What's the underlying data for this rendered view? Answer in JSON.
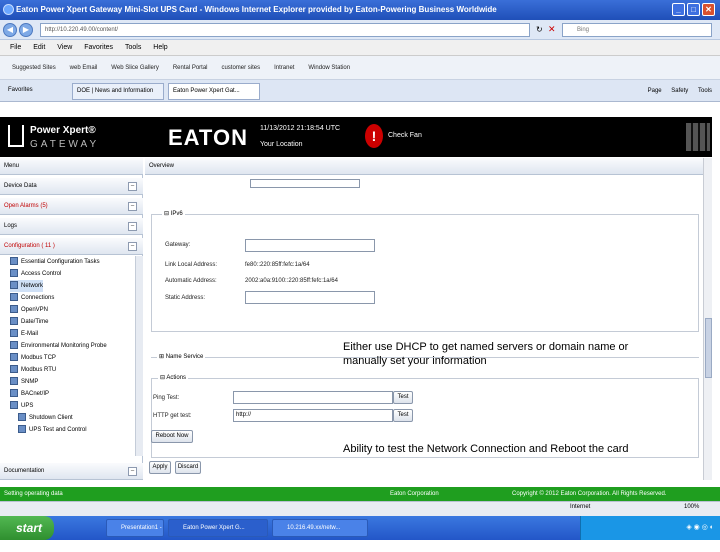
{
  "window": {
    "title": "Eaton Power Xpert Gateway Mini-Slot UPS Card - Windows Internet Explorer provided by Eaton-Powering Business Worldwide"
  },
  "browser": {
    "address": "http://10.220.49.00/content/",
    "search_placeholder": "Bing",
    "menu": [
      "File",
      "Edit",
      "View",
      "Favorites",
      "Tools",
      "Help"
    ],
    "favorites": [
      "Suggested Sites",
      "web Email",
      "Web Slice Gallery",
      "Rental Portal",
      "customer sites",
      "Intranet",
      "Window Station"
    ],
    "tabs": [
      {
        "label": "Favorites"
      },
      {
        "label": "DOE | News and Information"
      },
      {
        "label": "Eaton Power Xpert Gat..."
      }
    ],
    "commands": [
      "Page",
      "Safety",
      "Tools"
    ]
  },
  "header": {
    "brand": "Power Xpert®",
    "subbrand": "GATEWAY",
    "company": "EATON",
    "datetime": "11/13/2012 21:18:54 UTC",
    "location": "Your Location",
    "alert_text": "Check Fan"
  },
  "sidebar": {
    "menu_label": "Menu",
    "device_data": "Device Data",
    "open_alarms": "Open Alarms (5)",
    "logs": "Logs",
    "configuration": "Configuration ( 11 )",
    "tree": [
      "Essential Configuration Tasks",
      "Access Control",
      "Network",
      "Connections",
      "OpenVPN",
      "Date/Time",
      "E-Mail",
      "Environmental Monitoring Probe",
      "Modbus TCP",
      "Modbus RTU",
      "SNMP",
      "BACnet/IP",
      "UPS",
      "Shutdown Client",
      "UPS Test and Control"
    ],
    "documentation": "Documentation"
  },
  "content": {
    "header": "Overview",
    "ipv6": {
      "legend": "IPv6",
      "gateway_label": "Gateway:",
      "gateway_value": "",
      "link_local_label": "Link Local Address:",
      "link_local_value": "fe80::220:85ff:fefc:1a/64",
      "auto_label": "Automatic Address:",
      "auto_value": "2002:a0a:9100::220:85ff:fefc:1a/64",
      "static_label": "Static Address:",
      "static_value": ""
    },
    "name_service": {
      "legend": "Name Service"
    },
    "actions": {
      "legend": "Actions",
      "ping_label": "Ping Test:",
      "ping_value": "",
      "ping_btn": "Test",
      "http_label": "HTTP get test:",
      "http_value": "http://",
      "http_btn": "Test",
      "reboot_btn": "Reboot Now"
    },
    "apply_btn": "Apply",
    "discard_btn": "Discard"
  },
  "annotations": {
    "dhcp": "Either use DHCP to get named servers or domain name or manually set your information",
    "reboot": "Ability to test the Network Connection  and Reboot the card"
  },
  "status": {
    "left": "Setting operating data",
    "middle": "Eaton Corporation",
    "right": "Copyright © 2012 Eaton Corporation. All Rights Reserved."
  },
  "taskbar": {
    "start": "start",
    "tasks": [
      "Presentation1 - Mic...",
      "Eaton Power Xpert G...",
      "10.216.49.xx/netw..."
    ],
    "internet_zone": "Internet",
    "zoom": "100%"
  }
}
